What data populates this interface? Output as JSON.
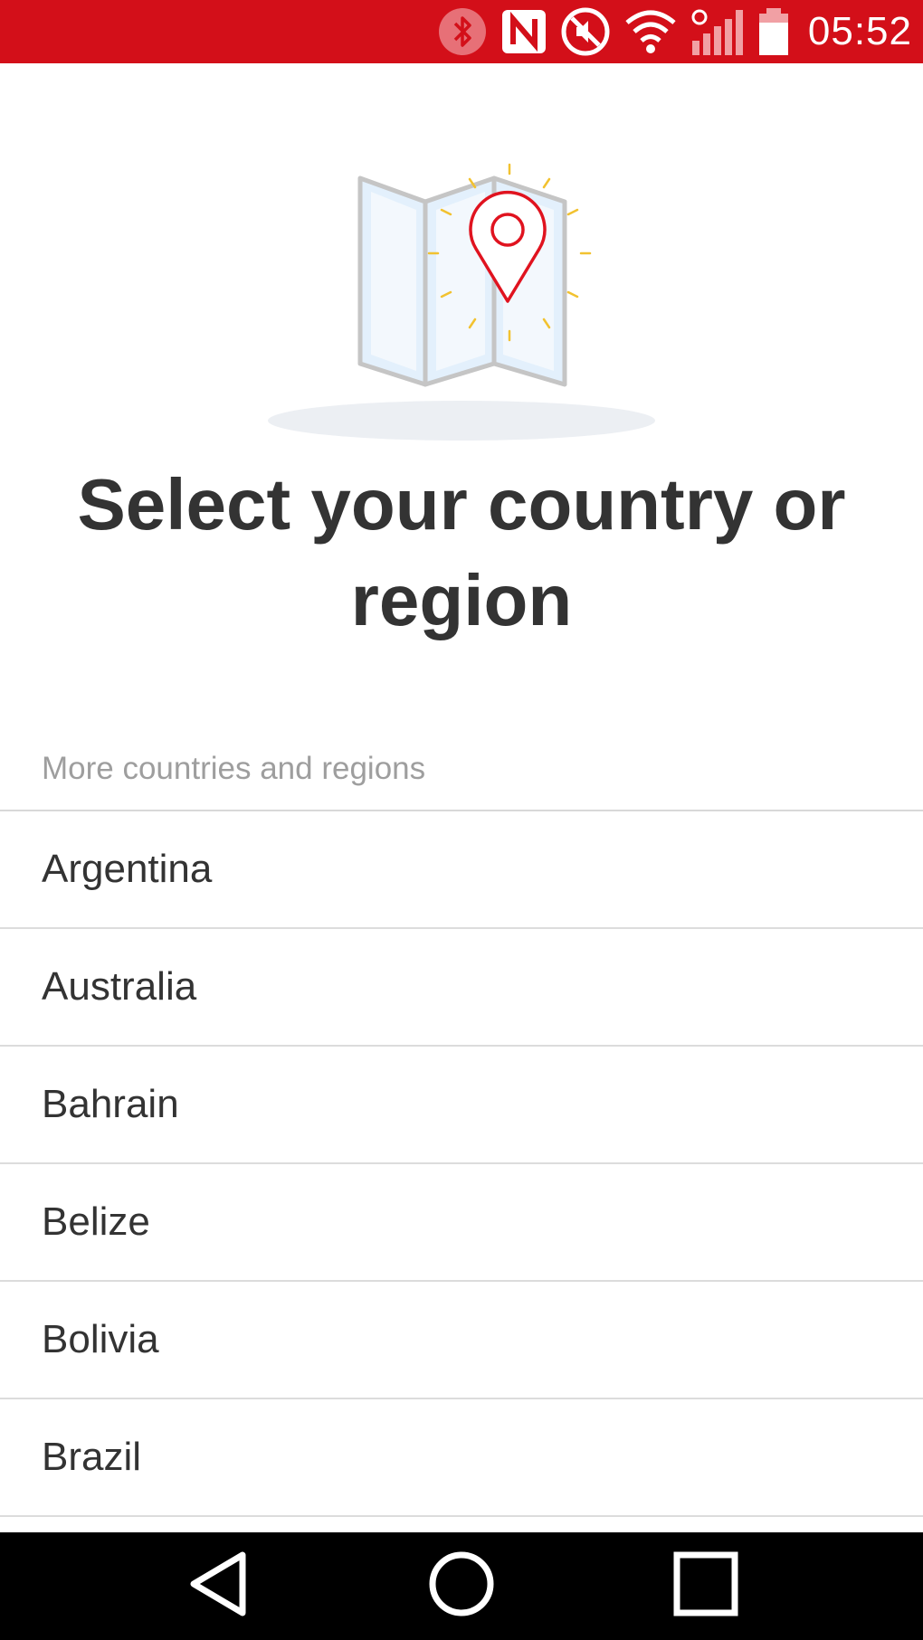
{
  "status_bar": {
    "time": "05:52",
    "background_color": "#d30f19",
    "icons": [
      "bluetooth-icon",
      "nfc-icon",
      "mute-icon",
      "wifi-icon",
      "signal-icon",
      "battery-icon"
    ]
  },
  "main": {
    "illustration_icon": "map-pin-icon",
    "title": "Select your country or region",
    "section_label": "More countries and regions",
    "countries": [
      {
        "label": "Argentina"
      },
      {
        "label": "Australia"
      },
      {
        "label": "Bahrain"
      },
      {
        "label": "Belize"
      },
      {
        "label": "Bolivia"
      },
      {
        "label": "Brazil"
      }
    ]
  },
  "nav_bar": {
    "buttons": [
      "back-icon",
      "home-icon",
      "recents-icon"
    ]
  },
  "colors": {
    "accent": "#d30f19",
    "text_primary": "#333333",
    "text_secondary": "#9e9e9e",
    "divider": "#dcdcdc",
    "map_sparkle": "#f2c230"
  }
}
